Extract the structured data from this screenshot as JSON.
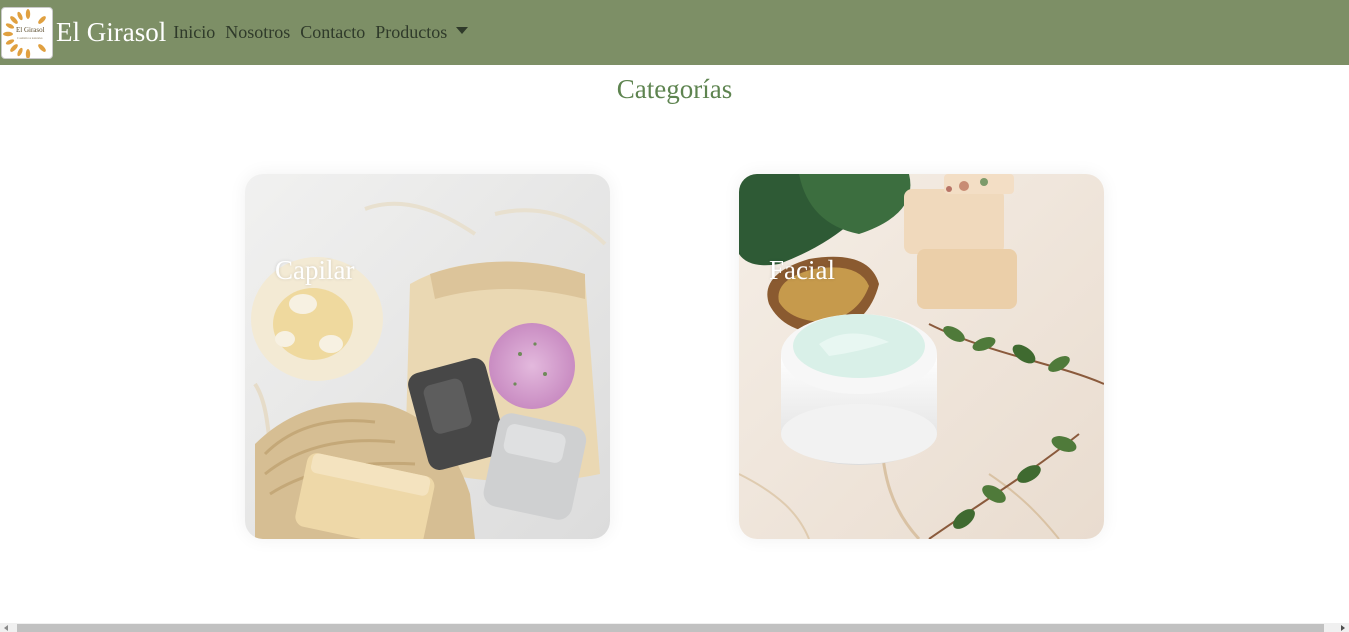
{
  "navbar": {
    "logo_text": "El Girasol",
    "logo_subtext": "Cosméticos naturales",
    "brand": "El Girasol",
    "links": [
      {
        "label": "Inicio"
      },
      {
        "label": "Nosotros"
      },
      {
        "label": "Contacto"
      },
      {
        "label": "Productos"
      }
    ]
  },
  "main": {
    "title": "Categorías",
    "cards": [
      {
        "label": "Capilar"
      },
      {
        "label": "Facial"
      }
    ]
  },
  "colors": {
    "navbar_bg": "#7d8f66",
    "title": "#5e8450",
    "brand_text": "#ffffff"
  }
}
